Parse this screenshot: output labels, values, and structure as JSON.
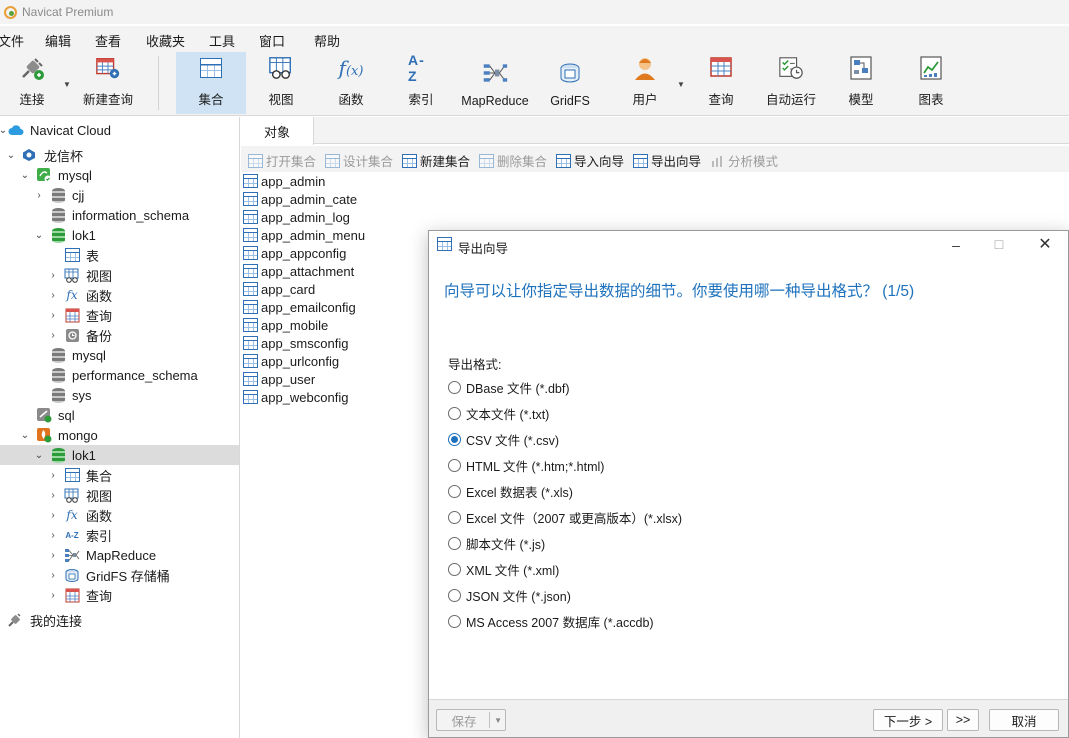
{
  "window": {
    "title": "Navicat Premium"
  },
  "menu": [
    "文件",
    "编辑",
    "查看",
    "收藏夹",
    "工具",
    "窗口",
    "帮助"
  ],
  "toolbar": [
    {
      "label": "连接",
      "icon": "plug-icon"
    },
    {
      "label": "新建查询",
      "icon": "new-query-icon"
    },
    {
      "label": "集合",
      "icon": "collection-icon",
      "active": true
    },
    {
      "label": "视图",
      "icon": "view-icon"
    },
    {
      "label": "函数",
      "icon": "function-icon"
    },
    {
      "label": "索引",
      "icon": "index-icon"
    },
    {
      "label": "MapReduce",
      "icon": "mapreduce-icon"
    },
    {
      "label": "GridFS",
      "icon": "gridfs-icon"
    },
    {
      "label": "用户",
      "icon": "user-icon"
    },
    {
      "label": "查询",
      "icon": "query-icon"
    },
    {
      "label": "自动运行",
      "icon": "automation-icon"
    },
    {
      "label": "模型",
      "icon": "model-icon"
    },
    {
      "label": "图表",
      "icon": "chart-icon"
    }
  ],
  "tree": [
    {
      "label": "Navicat Cloud",
      "icon": "cloud-icon"
    },
    {
      "label": "龙信杯",
      "icon": "project-icon"
    },
    {
      "label": "mysql",
      "icon": "mysql-connection-icon"
    },
    {
      "label": "cjj",
      "icon": "database-icon"
    },
    {
      "label": "information_schema",
      "icon": "database-icon"
    },
    {
      "label": "lok1",
      "icon": "database-open-icon"
    },
    {
      "label": "表",
      "icon": "table-icon"
    },
    {
      "label": "视图",
      "icon": "view-icon"
    },
    {
      "label": "函数",
      "icon": "function-icon"
    },
    {
      "label": "查询",
      "icon": "query-icon"
    },
    {
      "label": "备份",
      "icon": "backup-icon"
    },
    {
      "label": "mysql",
      "icon": "database-icon"
    },
    {
      "label": "performance_schema",
      "icon": "database-icon"
    },
    {
      "label": "sys",
      "icon": "database-icon"
    },
    {
      "label": "sql",
      "icon": "sql-connection-icon"
    },
    {
      "label": "mongo",
      "icon": "mongo-connection-icon"
    },
    {
      "label": "lok1",
      "icon": "database-open-icon",
      "selected": true
    },
    {
      "label": "集合",
      "icon": "collection-icon"
    },
    {
      "label": "视图",
      "icon": "view-icon"
    },
    {
      "label": "函数",
      "icon": "function-icon"
    },
    {
      "label": "索引",
      "icon": "index-icon"
    },
    {
      "label": "MapReduce",
      "icon": "mapreduce-icon"
    },
    {
      "label": "GridFS 存储桶",
      "icon": "gridfs-icon"
    },
    {
      "label": "查询",
      "icon": "query-icon"
    },
    {
      "label": "我的连接",
      "icon": "my-connections-icon"
    }
  ],
  "main": {
    "tab": "对象",
    "subtoolbar": [
      {
        "label": "打开集合",
        "enabled": false
      },
      {
        "label": "设计集合",
        "enabled": false
      },
      {
        "label": "新建集合",
        "enabled": true
      },
      {
        "label": "删除集合",
        "enabled": false
      },
      {
        "label": "导入向导",
        "enabled": true
      },
      {
        "label": "导出向导",
        "enabled": true
      },
      {
        "label": "分析模式",
        "enabled": false
      }
    ],
    "objects": [
      "app_admin",
      "app_admin_cate",
      "app_admin_log",
      "app_admin_menu",
      "app_appconfig",
      "app_attachment",
      "app_card",
      "app_emailconfig",
      "app_mobile",
      "app_smsconfig",
      "app_urlconfig",
      "app_user",
      "app_webconfig"
    ]
  },
  "dialog": {
    "title": "导出向导",
    "heading": "向导可以让你指定导出数据的细节。你要使用哪一种导出格式？ (1/5)",
    "format_label": "导出格式:",
    "formats": [
      {
        "label": "DBase 文件 (*.dbf)",
        "selected": false
      },
      {
        "label": "文本文件 (*.txt)",
        "selected": false
      },
      {
        "label": "CSV 文件 (*.csv)",
        "selected": true
      },
      {
        "label": "HTML 文件 (*.htm;*.html)",
        "selected": false
      },
      {
        "label": "Excel 数据表 (*.xls)",
        "selected": false
      },
      {
        "label": "Excel 文件（2007 或更高版本）(*.xlsx)",
        "selected": false
      },
      {
        "label": "脚本文件 (*.js)",
        "selected": false
      },
      {
        "label": "XML 文件 (*.xml)",
        "selected": false
      },
      {
        "label": "JSON 文件 (*.json)",
        "selected": false
      },
      {
        "label": "MS Access 2007 数据库 (*.accdb)",
        "selected": false
      }
    ],
    "buttons": {
      "save": "保存",
      "next": "下一步 >",
      "last": ">>",
      "cancel": "取消"
    }
  },
  "colors": {
    "accent": "#1e72bd",
    "selection": "#cfe3f4"
  }
}
